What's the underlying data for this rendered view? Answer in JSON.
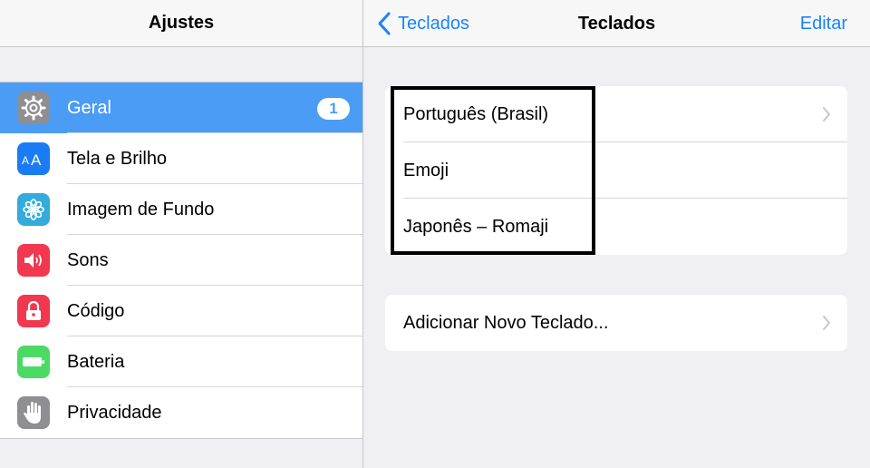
{
  "left": {
    "title": "Ajustes",
    "items": [
      {
        "label": "Geral",
        "icon": "gear-icon",
        "color": "#8e8e93",
        "selected": true,
        "badge": "1"
      },
      {
        "label": "Tela e Brilho",
        "icon": "text-size-icon",
        "color": "#1a7cf4",
        "selected": false
      },
      {
        "label": "Imagem de Fundo",
        "icon": "flower-icon",
        "color": "#35aadc",
        "selected": false
      },
      {
        "label": "Sons",
        "icon": "speaker-icon",
        "color": "#f1384f",
        "selected": false
      },
      {
        "label": "Código",
        "icon": "lock-icon",
        "color": "#f1384f",
        "selected": false
      },
      {
        "label": "Bateria",
        "icon": "battery-icon",
        "color": "#4cd964",
        "selected": false
      },
      {
        "label": "Privacidade",
        "icon": "hand-icon",
        "color": "#8e8e93",
        "selected": false
      }
    ]
  },
  "right": {
    "back_label": "Teclados",
    "title": "Teclados",
    "edit_label": "Editar",
    "keyboards": [
      "Português (Brasil)",
      "Emoji",
      "Japonês – Romaji"
    ],
    "add_label": "Adicionar Novo Teclado..."
  },
  "colors": {
    "accent": "#1a82fb",
    "selection": "#4a9cf5",
    "background": "#efeff4"
  }
}
